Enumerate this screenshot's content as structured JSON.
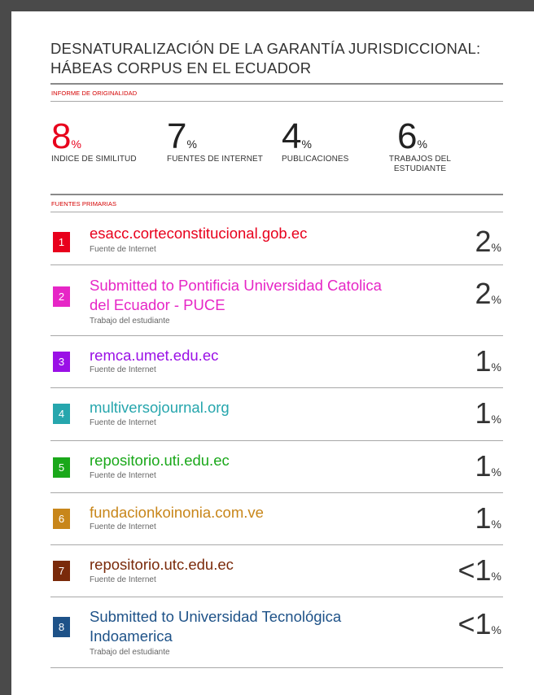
{
  "document": {
    "title_line1": "DESNATURALIZACIÓN DE LA GARANTÍA JURISDICCIONAL:",
    "title_line2": "HÁBEAS CORPUS EN EL ECUADOR"
  },
  "originality_report_label": "INFORME DE ORIGINALIDAD",
  "stats": [
    {
      "value": "8",
      "unit": "%",
      "label_line1": "INDICE DE SIMILITUD",
      "label_line2": ""
    },
    {
      "value": "7",
      "unit": "%",
      "label_line1": "FUENTES DE INTERNET",
      "label_line2": ""
    },
    {
      "value": "4",
      "unit": "%",
      "label_line1": "PUBLICACIONES",
      "label_line2": ""
    },
    {
      "value": "6",
      "unit": "%",
      "label_line1": "TRABAJOS DEL",
      "label_line2": "ESTUDIANTE"
    }
  ],
  "primary_sources_label": "FUENTES PRIMARIAS",
  "sources": [
    {
      "index": "1",
      "name_line1": "esacc.corteconstitucional.gob.ec",
      "name_line2": "",
      "type": "Fuente de Internet",
      "percent": "2",
      "unit": "%",
      "color": "#e8001c"
    },
    {
      "index": "2",
      "name_line1": "Submitted to Pontificia Universidad Catolica",
      "name_line2": "del Ecuador - PUCE",
      "type": "Trabajo del estudiante",
      "percent": "2",
      "unit": "%",
      "color": "#e626c6"
    },
    {
      "index": "3",
      "name_line1": "remca.umet.edu.ec",
      "name_line2": "",
      "type": "Fuente de Internet",
      "percent": "1",
      "unit": "%",
      "color": "#9a10e6"
    },
    {
      "index": "4",
      "name_line1": "multiversojournal.org",
      "name_line2": "",
      "type": "Fuente de Internet",
      "percent": "1",
      "unit": "%",
      "color": "#26a6ad"
    },
    {
      "index": "5",
      "name_line1": "repositorio.uti.edu.ec",
      "name_line2": "",
      "type": "Fuente de Internet",
      "percent": "1",
      "unit": "%",
      "color": "#1aa81a"
    },
    {
      "index": "6",
      "name_line1": "fundacionkoinonia.com.ve",
      "name_line2": "",
      "type": "Fuente de Internet",
      "percent": "1",
      "unit": "%",
      "color": "#c8861a"
    },
    {
      "index": "7",
      "name_line1": "repositorio.utc.edu.ec",
      "name_line2": "",
      "type": "Fuente de Internet",
      "percent": "<1",
      "unit": "%",
      "color": "#7a2a0a"
    },
    {
      "index": "8",
      "name_line1": "Submitted to Universidad Tecnológica",
      "name_line2": "Indoamerica",
      "type": "Trabajo del estudiante",
      "percent": "<1",
      "unit": "%",
      "color": "#1e5288"
    }
  ]
}
